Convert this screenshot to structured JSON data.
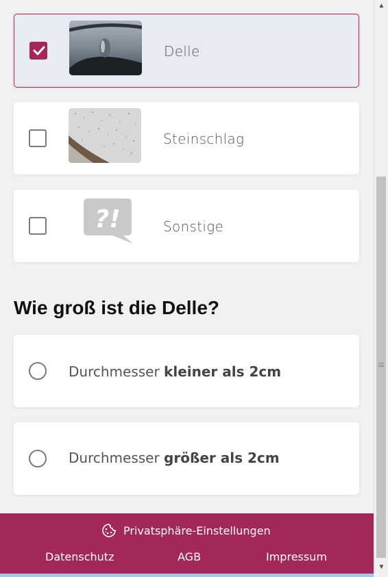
{
  "damage_options": [
    {
      "label": "Delle",
      "checked": true
    },
    {
      "label": "Steinschlag",
      "checked": false
    },
    {
      "label": "Sonstige",
      "checked": false
    }
  ],
  "size_question": {
    "title": "Wie groß ist die Delle?",
    "options": [
      {
        "prefix": "Durchmesser",
        "emphasis": "kleiner als 2cm"
      },
      {
        "prefix": "Durchmesser",
        "emphasis": "größer als 2cm"
      }
    ]
  },
  "footer": {
    "privacy_label": "Privatsphäre-Einstellungen",
    "links": [
      "Datenschutz",
      "AGB",
      "Impressum"
    ]
  },
  "colors": {
    "accent": "#a4275a",
    "selected_bg": "#e8ebf1",
    "page_bg": "#f1f1f3"
  }
}
